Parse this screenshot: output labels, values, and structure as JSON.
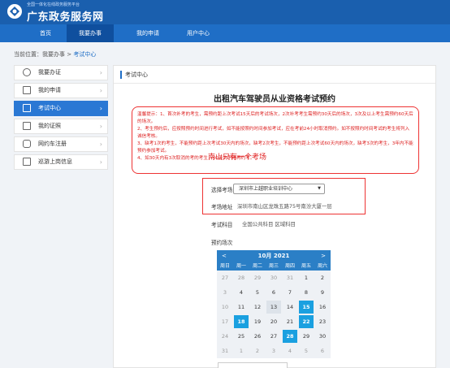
{
  "header": {
    "small_text": "全国一体化在线政务服务平台",
    "title": "广东政务服务网"
  },
  "nav": [
    "首页",
    "我要办事",
    "我的申请",
    "用户中心"
  ],
  "breadcrumb": {
    "prefix": "当前位置：我要办事 > ",
    "current": "考试中心"
  },
  "sidebar": {
    "items": [
      {
        "label": "我要办证",
        "icon": "user-icon"
      },
      {
        "label": "我的申请",
        "icon": "edit-icon"
      },
      {
        "label": "考试中心",
        "icon": "exam-icon",
        "active": true
      },
      {
        "label": "我的证照",
        "icon": "license-icon"
      },
      {
        "label": "网约车注册",
        "icon": "car-icon"
      },
      {
        "label": "巡游上岗信息",
        "icon": "taxi-icon"
      }
    ]
  },
  "panel": {
    "header": "考试中心",
    "title": "出租汽车驾驶员从业资格考试预约",
    "tips": [
      "温馨提示：1、首次补考的考生，需预约距上次考试15天后的考试场次，2次补考考生需预约30天后的场次，3次及以上考生需预约60天后的场次。",
      "2、考生预约后，应按照预约时间进行考试，如不能按照约时间参加考试，应在考前24小时取消预约。如不按照约时间考试的考生将列入诚信考核。",
      "3、缺考1次的考生，不能预约距上次考试30天内的场次，缺考2次考生，不能预约距上次考试60天内的场次，缺考3次的考生，3年内不能预约参加考试。",
      "4、如30天内有3次取消的考的考生，40天内不得再约考。"
    ],
    "form": {
      "venue_label": "选择考场",
      "venue_value": "深圳市上越职业培训中心",
      "address_label": "考场地址",
      "address_value": "深圳市南山区龙珠五路75号南汾大厦一层",
      "subject_label": "考试科目",
      "subject_value": "全国公共科目 区域科目",
      "session_label": "预约场次"
    },
    "annotation": "南山只有一个考场"
  },
  "calendar": {
    "month": "10月 2021",
    "prev": "<",
    "next": ">",
    "weekdays": [
      "周日",
      "周一",
      "周二",
      "周三",
      "周四",
      "周五",
      "周六"
    ],
    "weeks": [
      [
        "27",
        "28",
        "29",
        "30",
        "31",
        "1",
        "2"
      ],
      [
        "3",
        "4",
        "5",
        "6",
        "7",
        "8",
        "9"
      ],
      [
        "10",
        "11",
        "12",
        "13",
        "14",
        "15",
        "16"
      ],
      [
        "17",
        "18",
        "19",
        "20",
        "21",
        "22",
        "23"
      ],
      [
        "24",
        "25",
        "26",
        "27",
        "28",
        "29",
        "30"
      ],
      [
        "31",
        "1",
        "2",
        "3",
        "4",
        "5",
        "6"
      ]
    ],
    "available_days": [
      "15",
      "18",
      "22",
      "28"
    ],
    "today": "13",
    "colors": {
      "available": "#1aa0e0",
      "header": "#2b7fc6"
    }
  }
}
